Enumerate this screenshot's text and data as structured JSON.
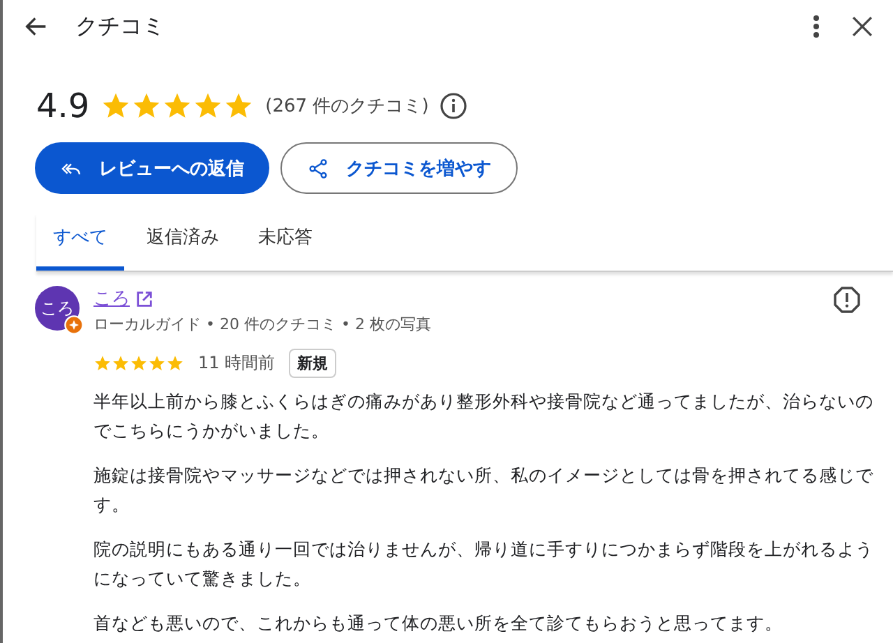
{
  "header": {
    "title": "クチコミ"
  },
  "summary": {
    "rating": "4.9",
    "stars": 5,
    "count": "(267 件のクチコミ)"
  },
  "actions": [
    {
      "label": "レビューへの返信",
      "kind": "primary"
    },
    {
      "label": "クチコミを増やす",
      "kind": "secondary"
    }
  ],
  "tabs": [
    {
      "label": "すべて",
      "selected": true
    },
    {
      "label": "返信済み",
      "selected": false
    },
    {
      "label": "未応答",
      "selected": false
    }
  ],
  "review": {
    "avatar": "ころ",
    "author": "ころ",
    "meta": "ローカルガイド • 20 件のクチコミ • 2 枚の写真",
    "stars": 5,
    "time": "11 時間前",
    "badge": "新規",
    "paragraphs": [
      "半年以上前から膝とふくらはぎの痛みがあり整形外科や接骨院など通ってましたが、治らないのでこちらにうかがいました。",
      "施錠は接骨院やマッサージなどでは押されない所、私のイメージとしては骨を押されてる感じです。",
      "院の説明にもある通り一回では治りませんが、帰り道に手すりにつかまらず階段を上がれるようになっていて驚きました。",
      "首なども悪いので、これからも通って体の悪い所を全て診てもらおうと思ってます。"
    ]
  }
}
